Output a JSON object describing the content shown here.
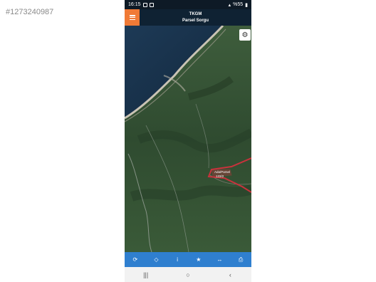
{
  "listing_id": "#1273240987",
  "status_bar": {
    "time": "16:15",
    "battery": "%55"
  },
  "header": {
    "title_line1": "TKGM",
    "title_line2": "Parsel Sorgu"
  },
  "map": {
    "parcel_label_line1": "Ada/Parsel",
    "parcel_label_line2": "133/2"
  },
  "toolbar": {
    "refresh_icon": "⟳",
    "location_icon": "◇",
    "info_icon": "i",
    "star_icon": "★",
    "measure_icon": "↔",
    "print_icon": "⎙"
  },
  "navbar": {
    "recents": "|||",
    "home": "○",
    "back": "‹"
  },
  "colors": {
    "accent": "#f07a36",
    "toolbar": "#2f7fcf",
    "header": "#0f2233",
    "parcel": "#c8323c"
  }
}
